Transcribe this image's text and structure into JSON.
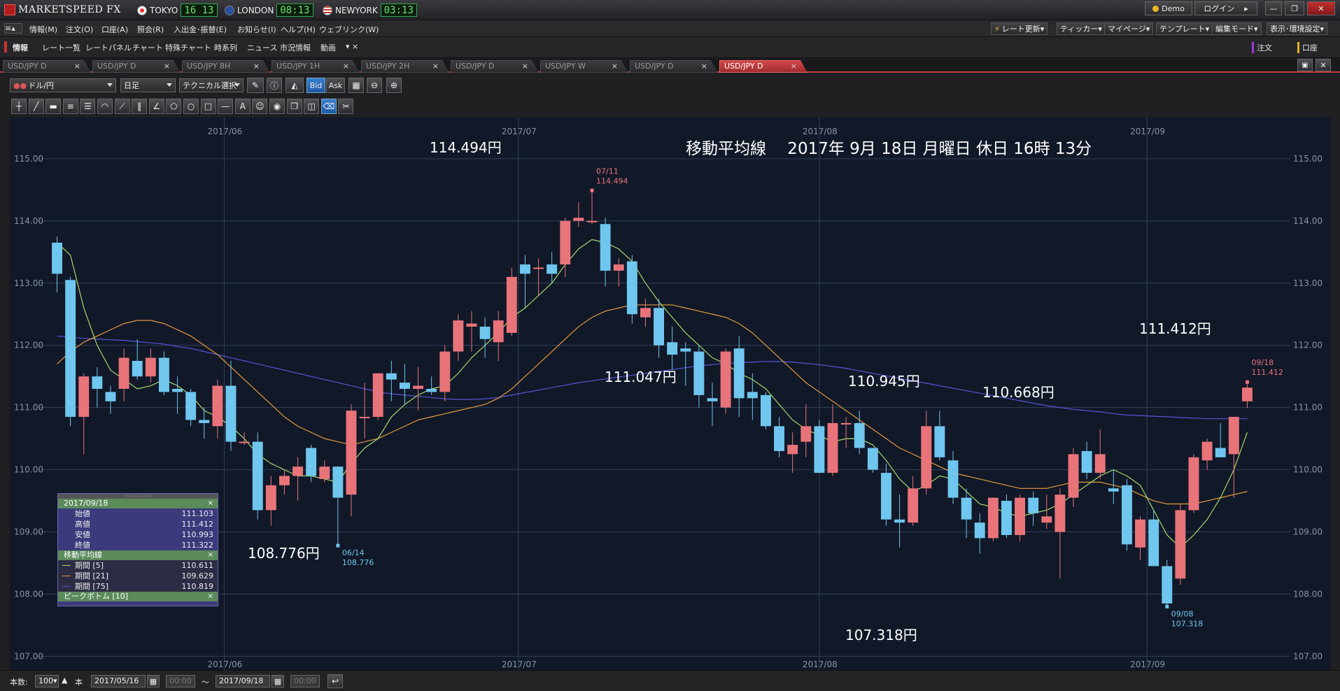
{
  "app": {
    "brand": "MARKETSPEED FX"
  },
  "clocks": [
    {
      "city": "TOKYO",
      "time": "16 13",
      "flag_color": "#e33"
    },
    {
      "city": "LONDON",
      "time": "08:13",
      "flag_color": "#2b4fa0"
    },
    {
      "city": "NEWYORK",
      "time": "03:13",
      "flag_color": "#c33"
    }
  ],
  "window": {
    "demo_label": "Demo",
    "login_label": "ログイン"
  },
  "menu": [
    "情報(M)",
    "注文(O)",
    "口座(A)",
    "照会(R)",
    "入出金･振替(E)",
    "お知らせ(I)",
    "ヘルプ(H)",
    "ウェブリンク(W)"
  ],
  "right_menu": [
    "レート更新",
    "ティッカー",
    "マイページ",
    "テンプレート",
    "編集モード",
    "表示･環境設定"
  ],
  "func_items": [
    "情報",
    "レート一覧",
    "レートパネル",
    "チャート",
    "特殊チャート",
    "時系列",
    "ニュース",
    "市況情報",
    "動画"
  ],
  "func_right": [
    "注文",
    "口座"
  ],
  "tabs": [
    "USD/JPY D",
    "USD/JPY D",
    "USD/JPY 8H",
    "USD/JPY 1H",
    "USD/JPY 2H",
    "USD/JPY D",
    "USD/JPY W",
    "USD/JPY D",
    "USD/JPY D"
  ],
  "active_tab": 8,
  "toolbar": {
    "pair": "ドル/円",
    "period": "日足",
    "technical": "テクニカル選択",
    "bid": "Bid",
    "ask": "Ask"
  },
  "bottom": {
    "count_label": "本数:",
    "count": "100",
    "unit": "本",
    "from_date": "2017/05/16",
    "from_time": "00:00",
    "tilde": "〜",
    "to_date": "2017/09/18",
    "to_time": "00:00"
  },
  "chart_data": {
    "type": "candlestick",
    "title": "移動平均線　 2017年 9月 18日 月曜日 休日 16時 13分",
    "month_labels": [
      "2017/06",
      "2017/07",
      "2017/08",
      "2017/09"
    ],
    "y_ticks": [
      "115.00",
      "114.00",
      "113.00",
      "112.00",
      "111.00",
      "110.00",
      "109.00",
      "108.00",
      "107.00"
    ],
    "ylim": [
      106.78,
      115.55
    ],
    "colors": {
      "up": "#e8747a",
      "down": "#6fc6ee",
      "ma5": "#a4d96a",
      "ma21": "#e39a3c",
      "ma75": "#5656d8",
      "grid": "#33405a"
    },
    "candles": [
      [
        113.65,
        113.75,
        112.85,
        113.15
      ],
      [
        113.05,
        113.1,
        110.7,
        110.85
      ],
      [
        110.85,
        111.55,
        110.25,
        111.5
      ],
      [
        111.5,
        111.65,
        111.0,
        111.3
      ],
      [
        111.25,
        111.35,
        110.9,
        111.1
      ],
      [
        111.3,
        111.95,
        111.1,
        111.8
      ],
      [
        111.75,
        112.1,
        111.45,
        111.5
      ],
      [
        111.5,
        111.95,
        111.4,
        111.8
      ],
      [
        111.8,
        111.9,
        111.2,
        111.25
      ],
      [
        111.3,
        111.5,
        110.9,
        111.25
      ],
      [
        111.25,
        111.3,
        110.7,
        110.8
      ],
      [
        110.8,
        111.0,
        110.5,
        110.75
      ],
      [
        110.7,
        111.45,
        110.5,
        111.35
      ],
      [
        111.35,
        111.75,
        110.3,
        110.45
      ],
      [
        110.45,
        110.6,
        110.4,
        110.45
      ],
      [
        110.45,
        110.6,
        109.2,
        109.35
      ],
      [
        109.35,
        109.9,
        109.1,
        109.75
      ],
      [
        109.75,
        110.0,
        109.6,
        109.9
      ],
      [
        109.9,
        110.2,
        109.5,
        110.05
      ],
      [
        110.35,
        110.4,
        109.8,
        109.9
      ],
      [
        109.85,
        110.15,
        109.8,
        110.05
      ],
      [
        110.05,
        110.05,
        108.78,
        109.55
      ],
      [
        109.6,
        111.05,
        109.25,
        110.95
      ],
      [
        110.85,
        111.4,
        110.5,
        110.85
      ],
      [
        110.85,
        111.55,
        110.8,
        111.55
      ],
      [
        111.55,
        111.75,
        111.1,
        111.45
      ],
      [
        111.4,
        111.7,
        111.05,
        111.3
      ],
      [
        111.3,
        111.65,
        110.95,
        111.35
      ],
      [
        111.3,
        111.5,
        111.2,
        111.25
      ],
      [
        111.25,
        112.0,
        111.1,
        111.9
      ],
      [
        111.9,
        112.5,
        111.75,
        112.4
      ],
      [
        112.3,
        112.55,
        111.9,
        112.35
      ],
      [
        112.3,
        112.45,
        111.8,
        112.1
      ],
      [
        112.05,
        112.55,
        111.75,
        112.4
      ],
      [
        112.2,
        113.25,
        112.15,
        113.1
      ],
      [
        113.3,
        113.45,
        112.6,
        113.15
      ],
      [
        113.25,
        113.4,
        112.8,
        113.25
      ],
      [
        113.3,
        113.5,
        113.0,
        113.15
      ],
      [
        113.3,
        114.05,
        113.1,
        114.0
      ],
      [
        114.0,
        114.3,
        113.9,
        114.05
      ],
      [
        114.0,
        114.49,
        113.95,
        114.0
      ],
      [
        113.95,
        114.05,
        112.95,
        113.2
      ],
      [
        113.2,
        113.4,
        112.95,
        113.3
      ],
      [
        113.35,
        113.45,
        112.35,
        112.5
      ],
      [
        112.45,
        112.75,
        112.3,
        112.6
      ],
      [
        112.6,
        112.75,
        111.8,
        112.0
      ],
      [
        112.05,
        112.3,
        111.6,
        111.85
      ],
      [
        111.95,
        112.05,
        111.35,
        111.9
      ],
      [
        111.9,
        112.0,
        111.0,
        111.2
      ],
      [
        111.15,
        111.4,
        110.7,
        111.1
      ],
      [
        111.0,
        111.95,
        110.9,
        111.9
      ],
      [
        111.95,
        112.15,
        110.85,
        111.15
      ],
      [
        111.25,
        111.55,
        110.8,
        111.15
      ],
      [
        111.2,
        111.25,
        110.65,
        110.7
      ],
      [
        110.7,
        110.85,
        110.2,
        110.3
      ],
      [
        110.25,
        110.6,
        109.95,
        110.4
      ],
      [
        110.45,
        111.05,
        110.2,
        110.7
      ],
      [
        110.7,
        110.8,
        109.95,
        109.95
      ],
      [
        109.95,
        111.05,
        109.9,
        110.75
      ],
      [
        110.75,
        110.85,
        110.35,
        110.75
      ],
      [
        110.75,
        110.95,
        110.25,
        110.35
      ],
      [
        110.35,
        110.35,
        109.95,
        110.0
      ],
      [
        109.95,
        110.1,
        109.1,
        109.2
      ],
      [
        109.2,
        109.6,
        108.75,
        109.15
      ],
      [
        109.15,
        109.9,
        109.1,
        109.7
      ],
      [
        109.7,
        110.95,
        109.6,
        110.7
      ],
      [
        110.7,
        110.95,
        110.15,
        110.2
      ],
      [
        110.15,
        110.3,
        109.45,
        109.55
      ],
      [
        109.55,
        109.7,
        108.9,
        109.2
      ],
      [
        109.15,
        109.3,
        108.65,
        108.9
      ],
      [
        108.9,
        109.55,
        108.85,
        109.55
      ],
      [
        109.5,
        109.6,
        108.9,
        108.95
      ],
      [
        108.95,
        109.6,
        108.85,
        109.55
      ],
      [
        109.55,
        109.65,
        109.1,
        109.3
      ],
      [
        109.15,
        109.6,
        109.05,
        109.25
      ],
      [
        109.0,
        109.7,
        108.25,
        109.6
      ],
      [
        109.55,
        110.35,
        109.4,
        110.25
      ],
      [
        110.3,
        110.45,
        109.85,
        109.95
      ],
      [
        109.95,
        110.65,
        109.85,
        110.25
      ],
      [
        109.7,
        110.0,
        109.45,
        109.65
      ],
      [
        109.75,
        109.85,
        108.7,
        108.8
      ],
      [
        108.75,
        109.25,
        108.55,
        109.2
      ],
      [
        109.2,
        109.35,
        108.6,
        108.45
      ],
      [
        108.45,
        108.55,
        107.8,
        107.85
      ],
      [
        108.25,
        109.45,
        108.15,
        109.35
      ],
      [
        109.35,
        110.25,
        109.3,
        110.2
      ],
      [
        110.15,
        110.5,
        110.0,
        110.45
      ],
      [
        110.35,
        110.75,
        110.2,
        110.2
      ],
      [
        110.25,
        110.85,
        109.55,
        110.85
      ],
      [
        111.1,
        111.41,
        110.99,
        111.32
      ]
    ],
    "ma5": [
      113.65,
      113.45,
      112.6,
      112.0,
      111.6,
      111.45,
      111.3,
      111.35,
      111.45,
      111.35,
      111.2,
      110.95,
      110.85,
      110.7,
      110.5,
      110.25,
      110.1,
      110.0,
      109.9,
      109.9,
      109.85,
      109.8,
      110.1,
      110.35,
      110.5,
      110.85,
      111.05,
      111.2,
      111.3,
      111.35,
      111.55,
      111.8,
      112.0,
      112.2,
      112.45,
      112.6,
      112.8,
      113.0,
      113.3,
      113.55,
      113.7,
      113.65,
      113.55,
      113.35,
      113.0,
      112.7,
      112.45,
      112.2,
      112.0,
      111.8,
      111.7,
      111.55,
      111.45,
      111.3,
      111.05,
      110.8,
      110.65,
      110.55,
      110.45,
      110.5,
      110.5,
      110.4,
      110.15,
      109.85,
      109.65,
      109.75,
      109.9,
      109.85,
      109.65,
      109.45,
      109.4,
      109.3,
      109.25,
      109.3,
      109.35,
      109.45,
      109.6,
      109.75,
      109.9,
      110.0,
      109.9,
      109.75,
      109.35,
      108.95,
      108.75,
      108.95,
      109.2,
      109.55,
      110.0,
      110.6
    ],
    "ma21": [
      111.7,
      111.9,
      112.05,
      112.15,
      112.25,
      112.35,
      112.4,
      112.4,
      112.35,
      112.25,
      112.15,
      112.0,
      111.85,
      111.65,
      111.45,
      111.25,
      111.05,
      110.85,
      110.7,
      110.6,
      110.5,
      110.45,
      110.4,
      110.45,
      110.5,
      110.6,
      110.7,
      110.8,
      110.85,
      110.9,
      110.95,
      111.0,
      111.05,
      111.15,
      111.3,
      111.5,
      111.7,
      111.9,
      112.1,
      112.3,
      112.45,
      112.55,
      112.6,
      112.65,
      112.65,
      112.65,
      112.65,
      112.6,
      112.55,
      112.5,
      112.45,
      112.35,
      112.2,
      112.0,
      111.8,
      111.6,
      111.4,
      111.25,
      111.1,
      110.95,
      110.8,
      110.65,
      110.5,
      110.35,
      110.25,
      110.15,
      110.05,
      109.95,
      109.9,
      109.85,
      109.8,
      109.75,
      109.7,
      109.7,
      109.7,
      109.75,
      109.8,
      109.8,
      109.8,
      109.75,
      109.7,
      109.6,
      109.5,
      109.45,
      109.45,
      109.45,
      109.5,
      109.55,
      109.6,
      109.65
    ],
    "ma75": [
      112.15,
      112.13,
      112.11,
      112.1,
      112.09,
      112.08,
      112.06,
      112.04,
      112.02,
      111.98,
      111.95,
      111.9,
      111.85,
      111.8,
      111.75,
      111.7,
      111.65,
      111.6,
      111.55,
      111.5,
      111.45,
      111.4,
      111.35,
      111.3,
      111.25,
      111.22,
      111.2,
      111.18,
      111.16,
      111.14,
      111.13,
      111.13,
      111.14,
      111.16,
      111.2,
      111.24,
      111.28,
      111.32,
      111.36,
      111.4,
      111.43,
      111.46,
      111.49,
      111.52,
      111.55,
      111.58,
      111.61,
      111.64,
      111.67,
      111.69,
      111.71,
      111.72,
      111.73,
      111.74,
      111.74,
      111.73,
      111.71,
      111.69,
      111.66,
      111.63,
      111.59,
      111.55,
      111.51,
      111.47,
      111.43,
      111.39,
      111.35,
      111.31,
      111.27,
      111.23,
      111.19,
      111.15,
      111.11,
      111.07,
      111.03,
      111.0,
      110.97,
      110.95,
      110.93,
      110.9,
      110.88,
      110.87,
      110.86,
      110.85,
      110.84,
      110.83,
      110.82,
      110.82,
      110.82,
      110.82
    ],
    "peaks": [
      {
        "i": 21,
        "type": "low",
        "date": "06/14",
        "value": "108.776",
        "big": "108.776円"
      },
      {
        "i": 40,
        "type": "high",
        "date": "07/11",
        "value": "114.494",
        "big": "114.494円"
      },
      {
        "i": 83,
        "type": "low",
        "date": "09/08",
        "value": "107.318",
        "big": "107.318円"
      },
      {
        "i": 89,
        "type": "high",
        "date": "09/18",
        "value": "111.412",
        "big": "111.412円"
      }
    ],
    "annotations": [
      {
        "text": "111.047円",
        "price": 111.047,
        "i": 58
      },
      {
        "text": "110.945円",
        "price": 110.945,
        "i": 68
      },
      {
        "text": "110.668円",
        "price": 110.668,
        "i": 79
      }
    ]
  },
  "data_panel": {
    "date": "2017/09/18",
    "rows": [
      {
        "label": "始値",
        "value": "111.103"
      },
      {
        "label": "高値",
        "value": "111.412"
      },
      {
        "label": "安値",
        "value": "110.993"
      },
      {
        "label": "終値",
        "value": "111.322"
      }
    ],
    "ma_header": "移動平均線",
    "ma_rows": [
      {
        "label": "期間 [5]",
        "value": "110.611",
        "color": "#a4d96a"
      },
      {
        "label": "期間 [21]",
        "value": "109.629",
        "color": "#e39a3c"
      },
      {
        "label": "期間 [75]",
        "value": "110.819",
        "color": "#5656d8"
      }
    ],
    "peak_header": "ピークボトム [10]"
  }
}
